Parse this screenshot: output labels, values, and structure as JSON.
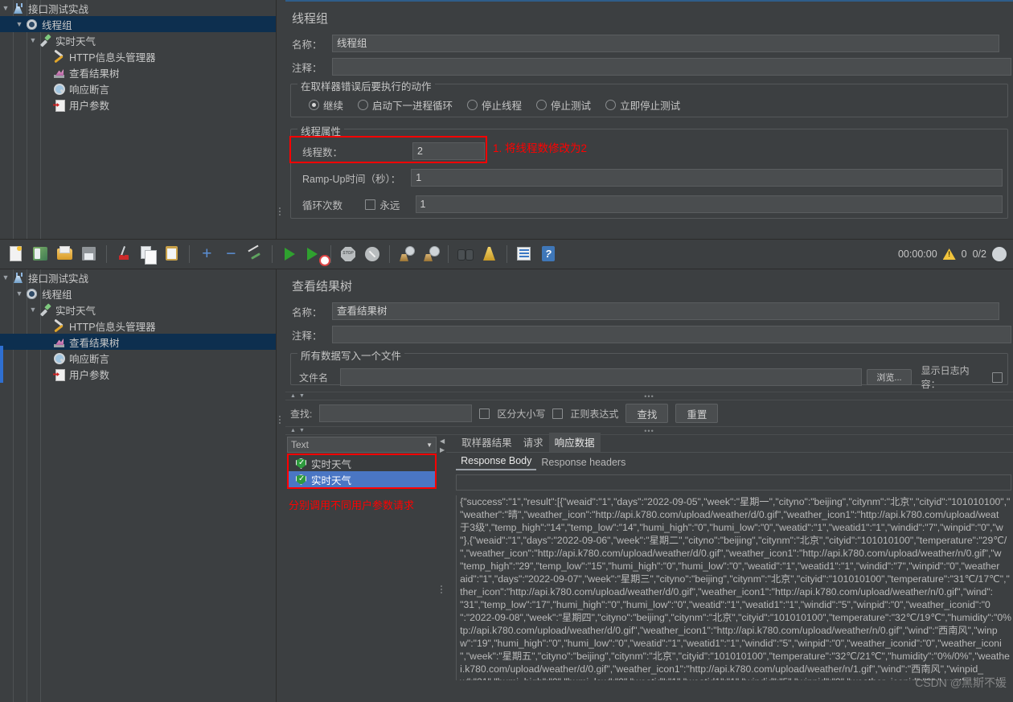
{
  "tree_top": {
    "items": [
      {
        "label": "接口测试实战",
        "icon": "flask-icon",
        "depth": 0,
        "twisty": "▼",
        "selected": false
      },
      {
        "label": "线程组",
        "icon": "gear-icon",
        "depth": 1,
        "twisty": "▼",
        "selected": true
      },
      {
        "label": "实时天气",
        "icon": "pipette-icon",
        "depth": 2,
        "twisty": "▼",
        "selected": false
      },
      {
        "label": "HTTP信息头管理器",
        "icon": "tools-icon",
        "depth": 3,
        "twisty": "",
        "selected": false
      },
      {
        "label": "查看结果树",
        "icon": "chart-icon",
        "depth": 3,
        "twisty": "",
        "selected": false
      },
      {
        "label": "响应断言",
        "icon": "magnify-icon",
        "depth": 3,
        "twisty": "",
        "selected": false
      },
      {
        "label": "用户参数",
        "icon": "userparam-icon",
        "depth": 3,
        "twisty": "",
        "selected": false
      }
    ]
  },
  "tree_bottom": {
    "items": [
      {
        "label": "接口测试实战",
        "icon": "flask-icon",
        "depth": 0,
        "twisty": "▼",
        "selected": false
      },
      {
        "label": "线程组",
        "icon": "gear-icon",
        "depth": 1,
        "twisty": "▼",
        "selected": false
      },
      {
        "label": "实时天气",
        "icon": "pipette-icon",
        "depth": 2,
        "twisty": "▼",
        "selected": false
      },
      {
        "label": "HTTP信息头管理器",
        "icon": "tools-icon",
        "depth": 3,
        "twisty": "",
        "selected": false
      },
      {
        "label": "查看结果树",
        "icon": "chart-icon",
        "depth": 3,
        "twisty": "",
        "selected": true
      },
      {
        "label": "响应断言",
        "icon": "magnify-icon",
        "depth": 3,
        "twisty": "",
        "selected": false
      },
      {
        "label": "用户参数",
        "icon": "userparam-icon",
        "depth": 3,
        "twisty": "",
        "selected": false
      }
    ]
  },
  "thread_group": {
    "title": "线程组",
    "name_label": "名称：",
    "name_value": "线程组",
    "comment_label": "注释：",
    "comment_value": "",
    "error_action": {
      "legend": "在取样器错误后要执行的动作",
      "options": [
        {
          "label": "继续",
          "selected": true
        },
        {
          "label": "启动下一进程循环",
          "selected": false
        },
        {
          "label": "停止线程",
          "selected": false
        },
        {
          "label": "停止测试",
          "selected": false
        },
        {
          "label": "立即停止测试",
          "selected": false
        }
      ]
    },
    "properties": {
      "legend": "线程属性",
      "threads_label": "线程数：",
      "threads_value": "2",
      "rampup_label": "Ramp-Up时间（秒）：",
      "rampup_value": "1",
      "loop_label": "循环次数",
      "forever_label": "永远",
      "forever_checked": false,
      "loop_value": "1"
    },
    "annotation": "1. 将线程数修改为2"
  },
  "toolbar": {
    "buttons": [
      {
        "name": "new-icon",
        "title": "新建"
      },
      {
        "name": "templates-icon",
        "title": "模板"
      },
      {
        "name": "open-icon",
        "title": "打开"
      },
      {
        "name": "save-icon",
        "title": "保存"
      },
      {
        "name": "cut-icon",
        "title": "剪切"
      },
      {
        "name": "copy-icon",
        "title": "复制"
      },
      {
        "name": "paste-icon",
        "title": "粘贴"
      },
      {
        "name": "expand-all-icon",
        "title": "展开"
      },
      {
        "name": "collapse-all-icon",
        "title": "收起"
      },
      {
        "name": "toggle-icon",
        "title": "切换"
      },
      {
        "name": "start-icon",
        "title": "启动"
      },
      {
        "name": "start-no-pauses-icon",
        "title": "无停顿启动"
      },
      {
        "name": "stop-icon",
        "title": "停止"
      },
      {
        "name": "shutdown-icon",
        "title": "关闭"
      },
      {
        "name": "clear-icon",
        "title": "清除"
      },
      {
        "name": "clear-all-icon",
        "title": "清除全部"
      },
      {
        "name": "search-icon",
        "title": "搜索"
      },
      {
        "name": "reset-search-icon",
        "title": "重置搜索"
      },
      {
        "name": "function-helper-icon",
        "title": "函数助手"
      },
      {
        "name": "help-icon",
        "title": "帮助"
      }
    ],
    "status": {
      "timer": "00:00:00",
      "warning_icon": "warning-triangle-icon",
      "warning_count": "0",
      "threads": "0/2"
    }
  },
  "view_results_tree": {
    "title": "查看结果树",
    "name_label": "名称：",
    "name_value": "查看结果树",
    "comment_label": "注释：",
    "comment_value": "",
    "file_group_legend": "所有数据写入一个文件",
    "filename_label": "文件名",
    "filename_value": "",
    "browse_button": "浏览...",
    "show_log_label": "显示日志内容：",
    "show_log_checked": false,
    "search": {
      "label": "查找:",
      "value": "",
      "case_sensitive_label": "区分大小写",
      "case_sensitive_checked": false,
      "regex_label": "正则表达式",
      "regex_checked": false,
      "find_button": "查找",
      "reset_button": "重置"
    },
    "renderer_selected": "Text",
    "results": [
      {
        "label": "实时天气",
        "icon": "success-shield-icon",
        "selected": false
      },
      {
        "label": "实时天气",
        "icon": "success-shield-icon",
        "selected": true
      }
    ],
    "annotation": "分别调用不同用户参数请求",
    "tabs": [
      {
        "label": "取样器结果",
        "active": false
      },
      {
        "label": "请求",
        "active": false
      },
      {
        "label": "响应数据",
        "active": true
      }
    ],
    "subtabs": [
      {
        "label": "Response Body",
        "active": true
      },
      {
        "label": "Response headers",
        "active": false
      }
    ],
    "response_body": "{\"success\":\"1\",\"result\":[{\"weaid\":\"1\",\"days\":\"2022-09-05\",\"week\":\"星期一\",\"cityno\":\"beijing\",\"citynm\":\"北京\",\"cityid\":\"101010100\",\"\n\"weather\":\"晴\",\"weather_icon\":\"http://api.k780.com/upload/weather/d/0.gif\",\"weather_icon1\":\"http://api.k780.com/upload/weat\n于3级\",\"temp_high\":\"14\",\"temp_low\":\"14\",\"humi_high\":\"0\",\"humi_low\":\"0\",\"weatid\":\"1\",\"weatid1\":\"1\",\"windid\":\"7\",\"winpid\":\"0\",\"w\n\"},{\"weaid\":\"1\",\"days\":\"2022-09-06\",\"week\":\"星期二\",\"cityno\":\"beijing\",\"citynm\":\"北京\",\"cityid\":\"101010100\",\"temperature\":\"29℃/\n\",\"weather_icon\":\"http://api.k780.com/upload/weather/d/0.gif\",\"weather_icon1\":\"http://api.k780.com/upload/weather/n/0.gif\",\"w\n\"temp_high\":\"29\",\"temp_low\":\"15\",\"humi_high\":\"0\",\"humi_low\":\"0\",\"weatid\":\"1\",\"weatid1\":\"1\",\"windid\":\"7\",\"winpid\":\"0\",\"weather\naid\":\"1\",\"days\":\"2022-09-07\",\"week\":\"星期三\",\"cityno\":\"beijing\",\"citynm\":\"北京\",\"cityid\":\"101010100\",\"temperature\":\"31℃/17℃\",\"\nther_icon\":\"http://api.k780.com/upload/weather/d/0.gif\",\"weather_icon1\":\"http://api.k780.com/upload/weather/n/0.gif\",\"wind\":\n\"31\",\"temp_low\":\"17\",\"humi_high\":\"0\",\"humi_low\":\"0\",\"weatid\":\"1\",\"weatid1\":\"1\",\"windid\":\"5\",\"winpid\":\"0\",\"weather_iconid\":\"0\n\":\"2022-09-08\",\"week\":\"星期四\",\"cityno\":\"beijing\",\"citynm\":\"北京\",\"cityid\":\"101010100\",\"temperature\":\"32℃/19℃\",\"humidity\":\"0%\ntp://api.k780.com/upload/weather/d/0.gif\",\"weather_icon1\":\"http://api.k780.com/upload/weather/n/0.gif\",\"wind\":\"西南风\",\"winp\nw\":\"19\",\"humi_high\":\"0\",\"humi_low\":\"0\",\"weatid\":\"1\",\"weatid1\":\"1\",\"windid\":\"5\",\"winpid\":\"0\",\"weather_iconid\":\"0\",\"weather_iconi\n\",\"week\":\"星期五\",\"cityno\":\"beijing\",\"citynm\":\"北京\",\"cityid\":\"101010100\",\"temperature\":\"32℃/21℃\",\"humidity\":\"0%/0%\",\"weathe\ni.k780.com/upload/weather/d/0.gif\",\"weather_icon1\":\"http://api.k780.com/upload/weather/n/1.gif\",\"wind\":\"西南风\",\"winpid_\nw\":\"21\",\"humi_high\":\"0\",\"humi_low\":\"0\",\"weatid\":\"1\",\"weatid1\":\"1\",\"windid\":\"5\",\"winpid\":\"0\",\"weather_iconid\":\"0\",\"weather_iconi"
  },
  "watermark": "CSDN @黑斯不媛"
}
